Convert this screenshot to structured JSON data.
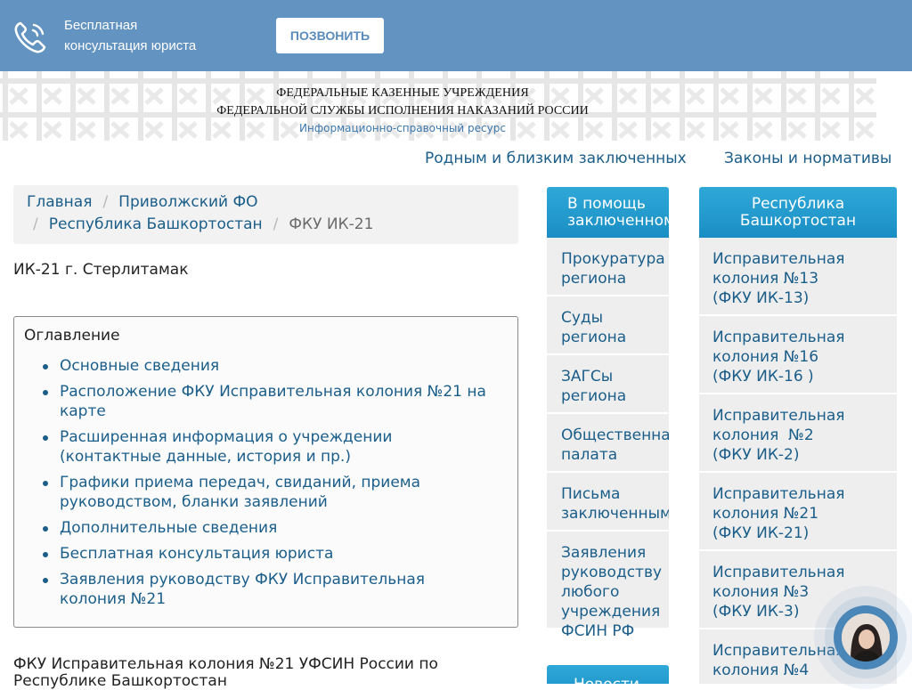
{
  "topbar": {
    "consult_line1": "Бесплатная",
    "consult_line2": "консультация юриста",
    "call_button": "ПОЗВОНИТЬ",
    "icon": "phone-icon"
  },
  "banner": {
    "line1": "ФЕДЕРАЛЬНЫЕ КАЗЕННЫЕ УЧРЕЖДЕНИЯ",
    "line2": "ФЕДЕРАЛЬНОЙ СЛУЖБЫ ИСПОЛНЕНИЯ НАКАЗАНИЙ РОССИИ",
    "line3": "Информационно-справочный ресурс"
  },
  "topnav": {
    "relatives": "Родным и близким заключенных",
    "laws": "Законы и нормативы"
  },
  "breadcrumb": {
    "home": "Главная",
    "district": "Приволжский ФО",
    "region": "Республика Башкортостан",
    "current": "ФКУ ИК-21",
    "separator": "/"
  },
  "page_title": "ИК-21 г. Стерлитамак",
  "toc": {
    "title": "Оглавление",
    "items": [
      {
        "l1": "Основные сведения"
      },
      {
        "l1": "Расположение ФКУ Исправительная колония №21 на",
        "l2": "карте"
      },
      {
        "l1": "Расширенная информация о учреждении",
        "l2": "(контактные данные, история и пр.)"
      },
      {
        "l1": "Графики приема передач, свиданий, приема",
        "l2": "руководством, бланки заявлений"
      },
      {
        "l1": "Дополнительные сведения"
      },
      {
        "l1": "Бесплатная консультация юриста"
      },
      {
        "l1": "Заявления руководству ФКУ Исправительная",
        "l2": "колония №21"
      }
    ]
  },
  "paragraph": {
    "l1": "ФКУ Исправительная колония №21 УФСИН России по",
    "l2": "Республике Башкортостан"
  },
  "sidebar_help": {
    "title_l1": "В помощь",
    "title_l2": "заключенному",
    "items": [
      {
        "l1": "Прокуратура",
        "l2": "региона"
      },
      {
        "l1": "Суды",
        "l2": "региона"
      },
      {
        "l1": "ЗАГСы",
        "l2": "региона"
      },
      {
        "l1": "Общественная",
        "l2": "палата"
      },
      {
        "l1": "Письма",
        "l2": "заключенным"
      },
      {
        "l1": "Заявления",
        "l2": "руководству",
        "l3": "любого",
        "l4": "учреждения",
        "l5": "ФСИН РФ"
      }
    ],
    "next_title": "Новости"
  },
  "sidebar_region": {
    "title_l1": "Республика",
    "title_l2": "Башкортостан",
    "items": [
      {
        "l1": "Исправительная",
        "l2": "колония №13",
        "l3": "(ФКУ ИК-13)"
      },
      {
        "l1": "Исправительная",
        "l2": "колония №16",
        "l3": "(ФКУ ИК-16 )"
      },
      {
        "l1": "Исправительная",
        "l2": "колония  №2",
        "l3": "(ФКУ ИК-2)"
      },
      {
        "l1": "Исправительная",
        "l2": "колония №21",
        "l3": "(ФКУ ИК-21)"
      },
      {
        "l1": "Исправительная",
        "l2": "колония №3",
        "l3": "(ФКУ ИК-3)"
      },
      {
        "l1": "Исправительная",
        "l2": "колония №4"
      }
    ]
  },
  "colors": {
    "topbar": "#6393c0",
    "link": "#1b5e8a",
    "sidebar_head": "#2fa8d8"
  }
}
